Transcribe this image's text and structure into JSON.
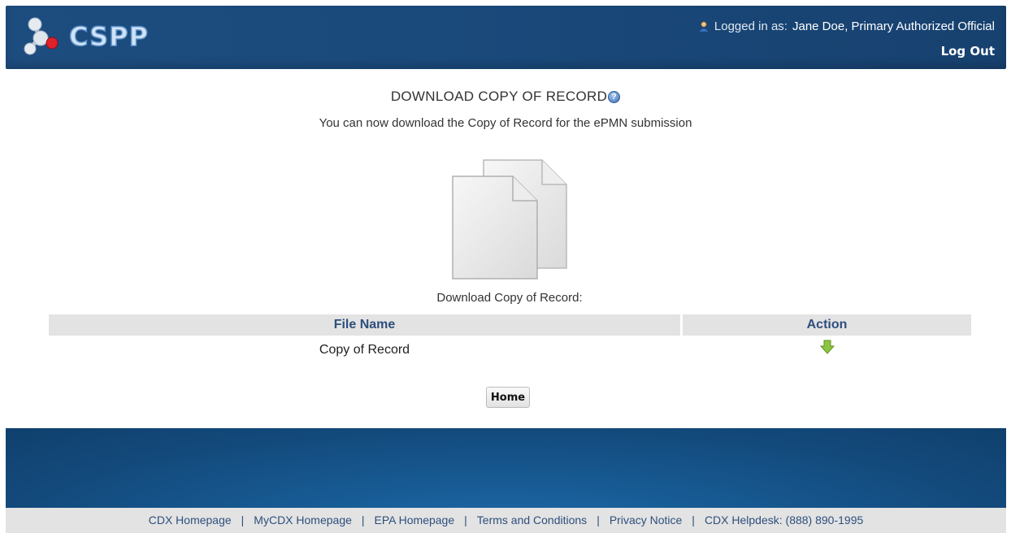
{
  "header": {
    "logo_text": "CSPP",
    "login_prefix": "Logged in as:",
    "user": "Jane Doe, Primary Authorized Official",
    "logout_label": "Log Out"
  },
  "page": {
    "title": "DOWNLOAD COPY OF RECORD",
    "subtitle": "You can now download the Copy of Record for the ePMN submission",
    "download_label": "Download Copy of Record:"
  },
  "table": {
    "columns": [
      "File Name",
      "Action"
    ],
    "rows": [
      {
        "file_name": "Copy of Record",
        "action_icon": "download-arrow-icon"
      }
    ]
  },
  "buttons": {
    "home_label": "Home"
  },
  "footer": {
    "links": [
      "CDX Homepage",
      "MyCDX Homepage",
      "EPA Homepage",
      "Terms and Conditions",
      "Privacy Notice",
      "CDX Helpdesk: (888) 890-1995"
    ],
    "separator": "|"
  },
  "colors": {
    "header_blue": "#1a4a7c",
    "link_blue": "#2d4f7d",
    "table_header_bg": "#e3e3e3",
    "download_arrow": "#8cc63f"
  }
}
